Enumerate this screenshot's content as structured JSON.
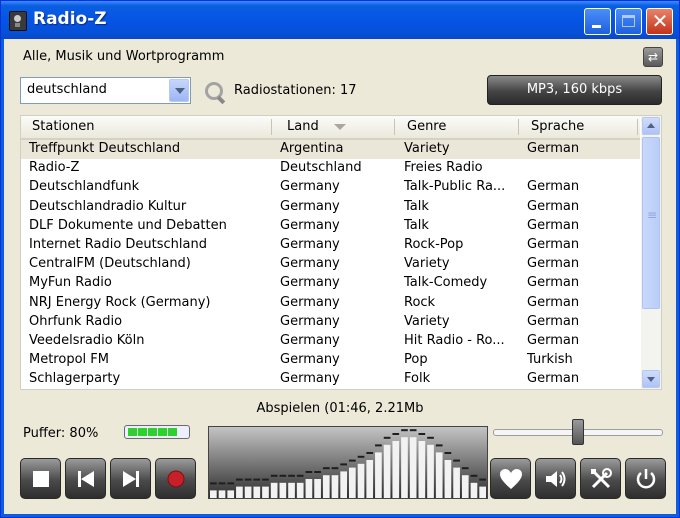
{
  "window": {
    "title": "Radio-Z"
  },
  "category": "Alle, Musik und Wortprogramm",
  "search": {
    "country_value": "deutschland",
    "count_text": "Radiostationen: 17"
  },
  "format_button": "MP3, 160 kbps",
  "columns": [
    "Stationen",
    "Land",
    "Genre",
    "Sprache"
  ],
  "stations": [
    {
      "name": "Treffpunkt Deutschland",
      "country": "Argentina",
      "genre": "Variety",
      "lang": "German"
    },
    {
      "name": "Radio-Z",
      "country": "Deutschland",
      "genre": "Freies Radio",
      "lang": ""
    },
    {
      "name": "Deutschlandfunk",
      "country": "Germany",
      "genre": "Talk-Public Ra...",
      "lang": "German"
    },
    {
      "name": "Deutschlandradio Kultur",
      "country": "Germany",
      "genre": "Talk",
      "lang": "German"
    },
    {
      "name": "DLF Dokumente und Debatten",
      "country": "Germany",
      "genre": "Talk",
      "lang": "German"
    },
    {
      "name": "Internet Radio Deutschland",
      "country": "Germany",
      "genre": "Rock-Pop",
      "lang": "German"
    },
    {
      "name": "CentralFM (Deutschland)",
      "country": "Germany",
      "genre": "Variety",
      "lang": "German"
    },
    {
      "name": "MyFun Radio",
      "country": "Germany",
      "genre": "Talk-Comedy",
      "lang": "German"
    },
    {
      "name": "NRJ Energy Rock (Germany)",
      "country": "Germany",
      "genre": "Rock",
      "lang": "German"
    },
    {
      "name": "Ohrfunk Radio",
      "country": "Germany",
      "genre": "Variety",
      "lang": "German"
    },
    {
      "name": "Veedelsradio Köln",
      "country": "Germany",
      "genre": "Hit Radio - Ro...",
      "lang": "German"
    },
    {
      "name": "Metropol FM",
      "country": "Germany",
      "genre": "Pop",
      "lang": "Turkish"
    },
    {
      "name": "Schlagerparty",
      "country": "Germany",
      "genre": "Folk",
      "lang": "German"
    }
  ],
  "status": "Abspielen (01:46, 2.21Mb",
  "buffer": {
    "label": "Puffer: 80%",
    "value": 0.8
  },
  "volume": 0.5,
  "visualizer_levels": [
    2,
    2,
    2,
    3,
    3,
    3,
    3,
    4,
    4,
    4,
    4,
    5,
    5,
    6,
    6,
    7,
    8,
    9,
    10,
    12,
    14,
    15,
    16,
    16,
    15,
    14,
    12,
    10,
    8,
    6,
    4,
    3
  ],
  "controls": {
    "stop": "stop-icon",
    "prev": "skip-back-icon",
    "next": "skip-forward-icon",
    "record": "record-icon",
    "favorite": "heart-icon",
    "volume": "speaker-icon",
    "tools": "tools-icon",
    "power": "power-icon"
  },
  "colors": {
    "title_bar": "#0554e4",
    "record_red": "#c8202a",
    "buffer_green": "#2fd12f",
    "selected_row": "#eae6d8"
  }
}
